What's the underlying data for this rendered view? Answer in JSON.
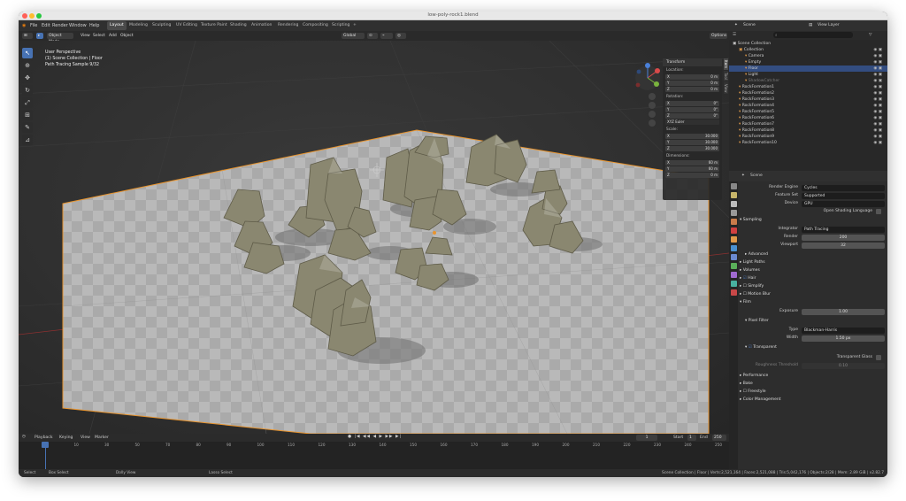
{
  "window_title": "low-poly-rock1.blend",
  "menu": [
    "File",
    "Edit",
    "Render",
    "Window",
    "Help"
  ],
  "workspaces": [
    "Layout",
    "Modeling",
    "Sculpting",
    "UV Editing",
    "Texture Paint",
    "Shading",
    "Animation",
    "Rendering",
    "Compositing",
    "Scripting"
  ],
  "active_workspace": "Layout",
  "add_workspace": "+",
  "header": {
    "mode": "Object Mode",
    "menus": [
      "View",
      "Select",
      "Add",
      "Object"
    ],
    "orientation": "Global",
    "options": "Options"
  },
  "viewport_overlay": {
    "line1": "User Perspective",
    "line2": "(1) Scene Collection | Floor",
    "line3": "Path Tracing Sample 9/32"
  },
  "npanel": {
    "title": "Transform",
    "location_label": "Location:",
    "location": [
      [
        "X",
        "0 m"
      ],
      [
        "Y",
        "0 m"
      ],
      [
        "Z",
        "0 m"
      ]
    ],
    "rotation_label": "Rotation:",
    "rotation": [
      [
        "X",
        "0°"
      ],
      [
        "Y",
        "0°"
      ],
      [
        "Z",
        "0°"
      ]
    ],
    "rotation_mode": "XYZ Euler",
    "scale_label": "Scale:",
    "scale": [
      [
        "X",
        "30.000"
      ],
      [
        "Y",
        "30.000"
      ],
      [
        "Z",
        "30.000"
      ]
    ],
    "dimensions_label": "Dimensions:",
    "dimensions": [
      [
        "X",
        "60 m"
      ],
      [
        "Y",
        "60 m"
      ],
      [
        "Z",
        "0 m"
      ]
    ],
    "tabs": [
      "Item",
      "Tool",
      "View"
    ]
  },
  "timeline": {
    "menus": [
      "Playback",
      "Keying",
      "View",
      "Marker"
    ],
    "current_frame": "1",
    "start_label": "Start",
    "start": "1",
    "end_label": "End",
    "end": "250",
    "ruler": [
      "1",
      "10",
      "30",
      "50",
      "70",
      "80",
      "90",
      "100",
      "110",
      "120",
      "130",
      "140",
      "150",
      "160",
      "170",
      "180",
      "190",
      "200",
      "210",
      "220",
      "230",
      "240",
      "250"
    ]
  },
  "statusbar": {
    "left": [
      "Select",
      "Box Select",
      "Dolly View",
      "Lasso Select"
    ],
    "right": "Scene Collection | Floor | Verts:2,521,164 | Faces:2,521,088 | Tris:5,042,176 | Objects:2/28 | Mem: 2.89 GiB | v2.82.7"
  },
  "outliner": {
    "scene": "Scene",
    "view_layer": "View Layer",
    "root": "Scene Collection",
    "items": [
      {
        "name": "Collection",
        "depth": 1
      },
      {
        "name": "Camera",
        "depth": 2
      },
      {
        "name": "Empty",
        "depth": 2
      },
      {
        "name": "Floor",
        "depth": 2,
        "selected": true
      },
      {
        "name": "Light",
        "depth": 2
      },
      {
        "name": "ShadowCatcher",
        "depth": 2,
        "dim": true
      },
      {
        "name": "RockFormation1",
        "depth": 1
      },
      {
        "name": "RockFormation2",
        "depth": 1
      },
      {
        "name": "RockFormation3",
        "depth": 1
      },
      {
        "name": "RockFormation4",
        "depth": 1
      },
      {
        "name": "RockFormation5",
        "depth": 1
      },
      {
        "name": "RockFormation6",
        "depth": 1
      },
      {
        "name": "RockFormation7",
        "depth": 1
      },
      {
        "name": "RockFormation8",
        "depth": 1
      },
      {
        "name": "RockFormation9",
        "depth": 1
      },
      {
        "name": "RockFormation10",
        "depth": 1
      }
    ]
  },
  "properties": {
    "context": "Scene",
    "render_engine_label": "Render Engine",
    "render_engine": "Cycles",
    "feature_set_label": "Feature Set",
    "feature_set": "Supported",
    "device_label": "Device",
    "device": "GPU",
    "osl": "Open Shading Language",
    "sampling": "Sampling",
    "integrator_label": "Integrator",
    "integrator": "Path Tracing",
    "render_label": "Render",
    "render_samples": "200",
    "viewport_label": "Viewport",
    "viewport_samples": "32",
    "advanced": "Advanced",
    "light_paths": "Light Paths",
    "volumes": "Volumes",
    "hair": "Hair",
    "simplify": "Simplify",
    "motion_blur": "Motion Blur",
    "film": "Film",
    "exposure_label": "Exposure",
    "exposure": "1.00",
    "pixel_filter": "Pixel Filter",
    "type_label": "Type",
    "filter_type": "Blackman-Harris",
    "width_label": "Width",
    "width": "1.50 px",
    "transparent": "Transparent",
    "transparent_glass": "Transparent Glass",
    "roughness_label": "Roughness Threshold",
    "roughness": "0.10",
    "performance": "Performance",
    "bake": "Bake",
    "freestyle": "Freestyle",
    "color_management": "Color Management"
  },
  "colors": {
    "accent": "#4772b3",
    "selection_outline": "#e8942e",
    "rock": "#8a8770",
    "floor": "#b4b4b4"
  }
}
